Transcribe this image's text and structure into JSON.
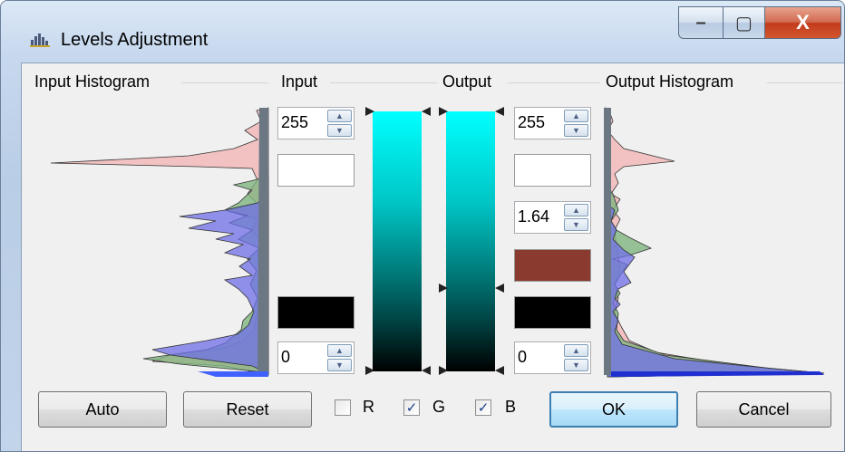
{
  "window": {
    "title": "Levels Adjustment",
    "app_icon": "levels-histogram-icon",
    "minimize_glyph": "–",
    "maximize_glyph": "▢",
    "close_glyph": "X"
  },
  "sections": {
    "input_histogram": "Input Histogram",
    "input": "Input",
    "output": "Output",
    "output_histogram": "Output Histogram"
  },
  "input": {
    "high_value": "255",
    "low_value": "0",
    "high_color": "#ffffff",
    "low_color": "#000000"
  },
  "output": {
    "high_value": "255",
    "gamma_value": "1.64",
    "low_value": "0",
    "high_color": "#ffffff",
    "mid_color": "#8b3a2f",
    "low_color": "#000000"
  },
  "spinner_glyphs": {
    "up": "▲",
    "down": "▼"
  },
  "check_glyph": "✓",
  "channels": [
    {
      "label": "R",
      "checked": false
    },
    {
      "label": "G",
      "checked": true
    },
    {
      "label": "B",
      "checked": true
    }
  ],
  "buttons": {
    "auto": "Auto",
    "reset": "Reset",
    "ok": "OK",
    "cancel": "Cancel"
  },
  "colors": {
    "gradient_top": "#00ffff",
    "gradient_bottom": "#000000",
    "histogram_red": "#f2b8b8",
    "histogram_green": "#7fb57f",
    "histogram_blue": "#6f6fe8",
    "histogram_gray": "#6b7884"
  }
}
